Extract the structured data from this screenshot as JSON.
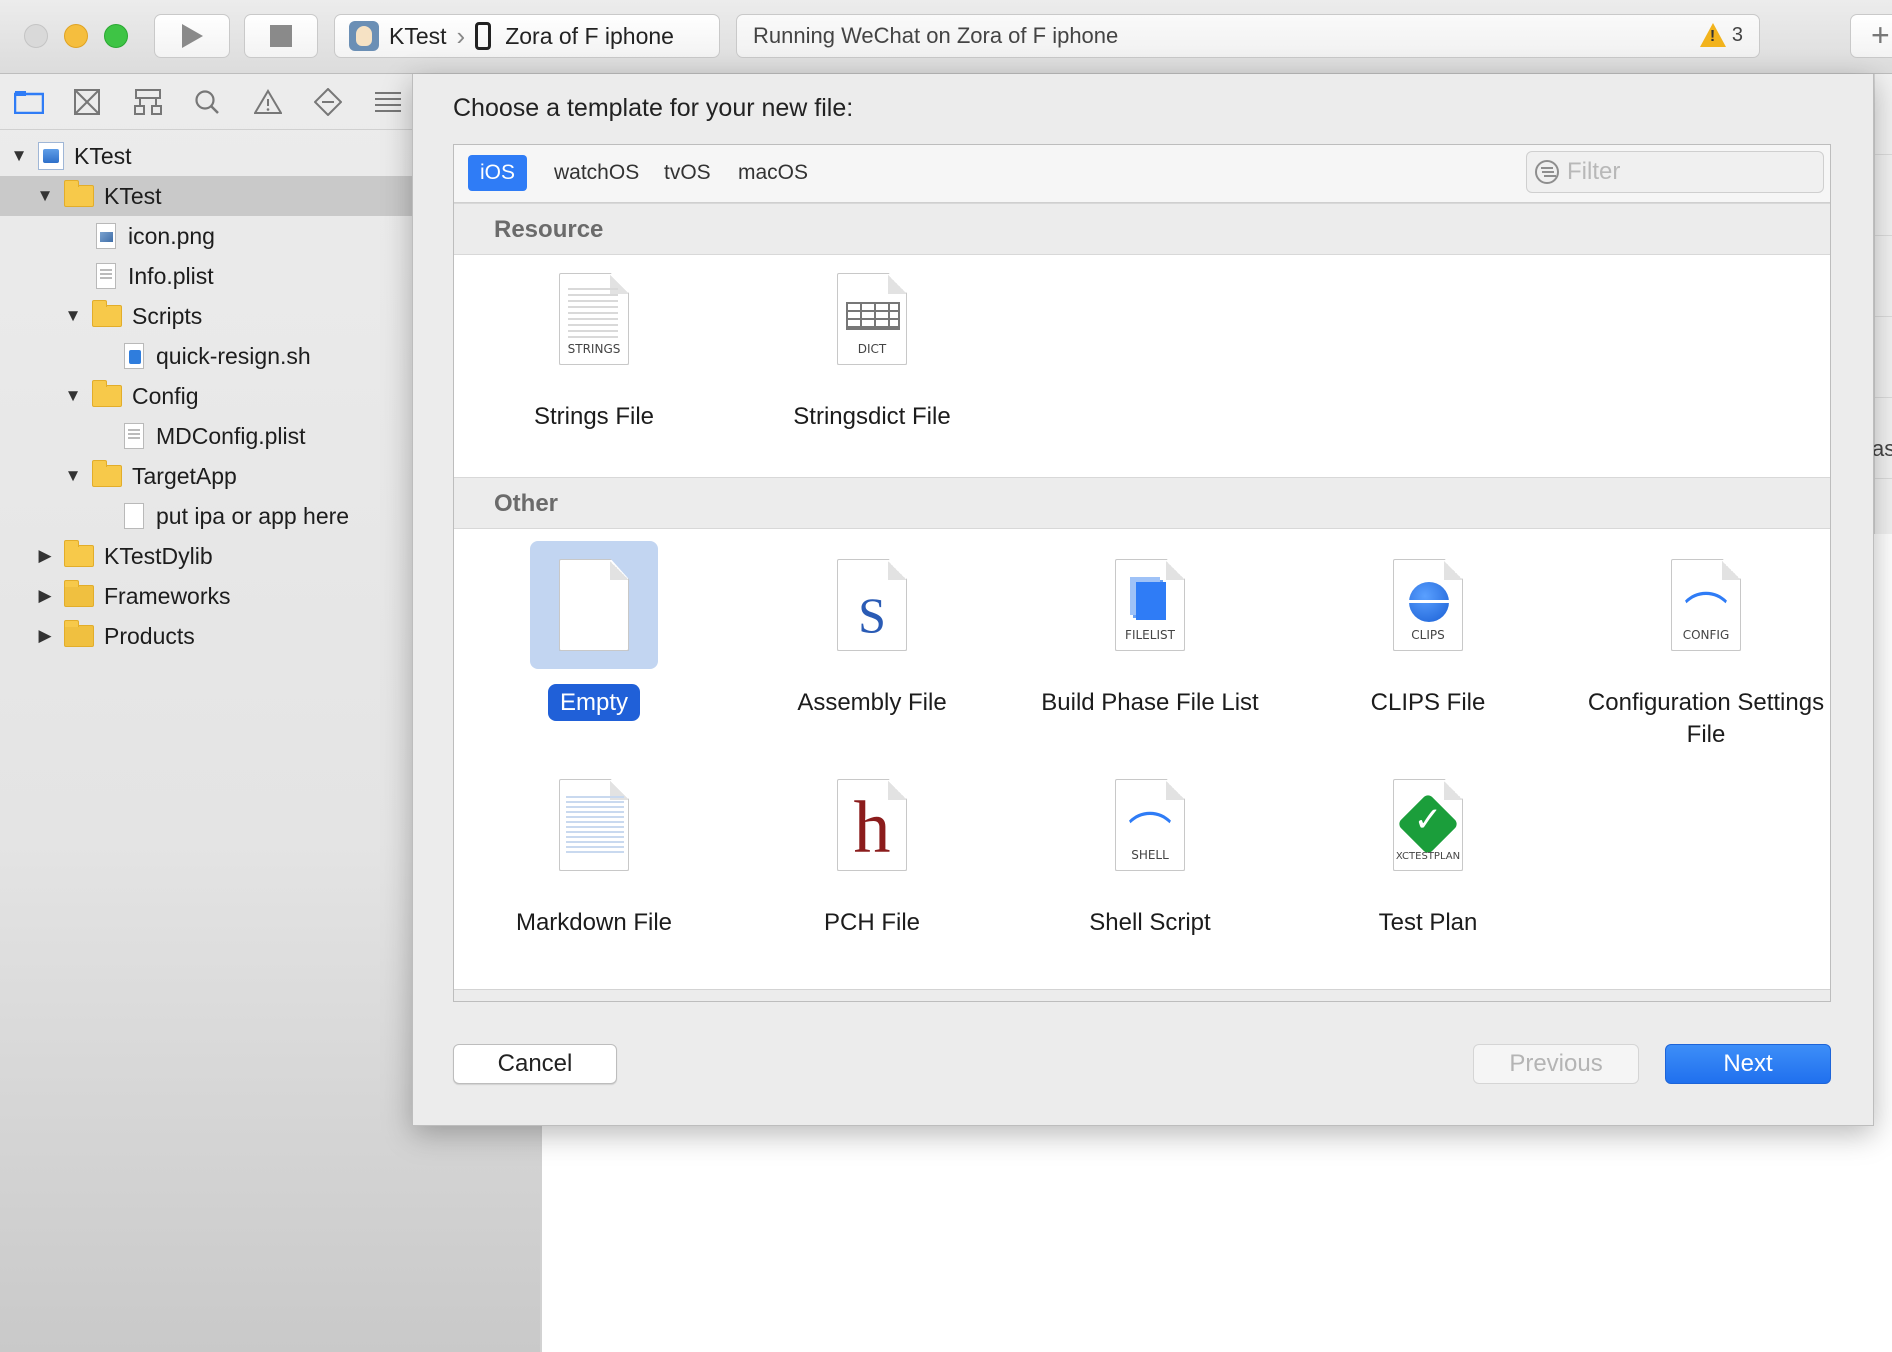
{
  "toolbar": {
    "scheme_project": "KTest",
    "scheme_device": "Zora of F iphone",
    "activity_text": "Running WeChat on Zora of F iphone",
    "warning_count": "3",
    "add_label": "+"
  },
  "sidebar": {
    "nav_icons": [
      "folder-icon",
      "source-control-icon",
      "hierarchy-icon",
      "search-icon",
      "warning-icon",
      "breakpoint-icon",
      "report-icon"
    ],
    "tree": [
      {
        "label": "KTest",
        "icon": "project-icon",
        "expanded": true
      },
      {
        "label": "KTest",
        "icon": "folder-icon",
        "expanded": true,
        "selected": true
      },
      {
        "label": "icon.png",
        "icon": "png-file-icon"
      },
      {
        "label": "Info.plist",
        "icon": "plist-file-icon"
      },
      {
        "label": "Scripts",
        "icon": "folder-icon",
        "expanded": true
      },
      {
        "label": "quick-resign.sh",
        "icon": "shell-file-icon"
      },
      {
        "label": "Config",
        "icon": "folder-icon",
        "expanded": true
      },
      {
        "label": "MDConfig.plist",
        "icon": "plist-file-icon"
      },
      {
        "label": "TargetApp",
        "icon": "folder-icon",
        "expanded": true
      },
      {
        "label": "put ipa or app here",
        "icon": "blank-file-icon"
      },
      {
        "label": "KTestDylib",
        "icon": "folder-icon",
        "expanded": false
      },
      {
        "label": "Frameworks",
        "icon": "folder-icon",
        "expanded": false
      },
      {
        "label": "Products",
        "icon": "folder-icon",
        "expanded": false
      }
    ]
  },
  "editor": {
    "clipped_text": "as"
  },
  "sheet": {
    "title": "Choose a template for your new file:",
    "platforms": [
      "iOS",
      "watchOS",
      "tvOS",
      "macOS"
    ],
    "active_platform": "iOS",
    "filter_placeholder": "Filter",
    "sections": [
      {
        "header": "Resource",
        "templates": [
          {
            "name": "Strings File",
            "tag": "STRINGS",
            "icon": "strings-file-icon"
          },
          {
            "name": "Stringsdict File",
            "tag": "DICT",
            "icon": "stringsdict-file-icon"
          }
        ]
      },
      {
        "header": "Other",
        "templates": [
          {
            "name": "Empty",
            "tag": "",
            "icon": "empty-file-icon",
            "selected": true
          },
          {
            "name": "Assembly File",
            "tag": "S",
            "icon": "assembly-file-icon"
          },
          {
            "name": "Build Phase File List",
            "tag": "FILELIST",
            "icon": "filelist-icon"
          },
          {
            "name": "CLIPS File",
            "tag": "CLIPS",
            "icon": "clips-file-icon"
          },
          {
            "name": "Configuration Settings File",
            "tag": "CONFIG",
            "icon": "config-file-icon"
          },
          {
            "name": "Markdown File",
            "tag": "",
            "icon": "markdown-file-icon"
          },
          {
            "name": "PCH File",
            "tag": "h",
            "icon": "pch-file-icon"
          },
          {
            "name": "Shell Script",
            "tag": "SHELL",
            "icon": "shell-script-icon"
          },
          {
            "name": "Test Plan",
            "tag": "XCTESTPLAN",
            "icon": "test-plan-icon"
          }
        ]
      }
    ],
    "buttons": {
      "cancel": "Cancel",
      "previous": "Previous",
      "next": "Next"
    }
  },
  "colors": {
    "accent": "#2f7cf6",
    "selection_bg": "#c2d5f1",
    "selected_label": "#2060d8",
    "warning": "#f2b31c"
  }
}
